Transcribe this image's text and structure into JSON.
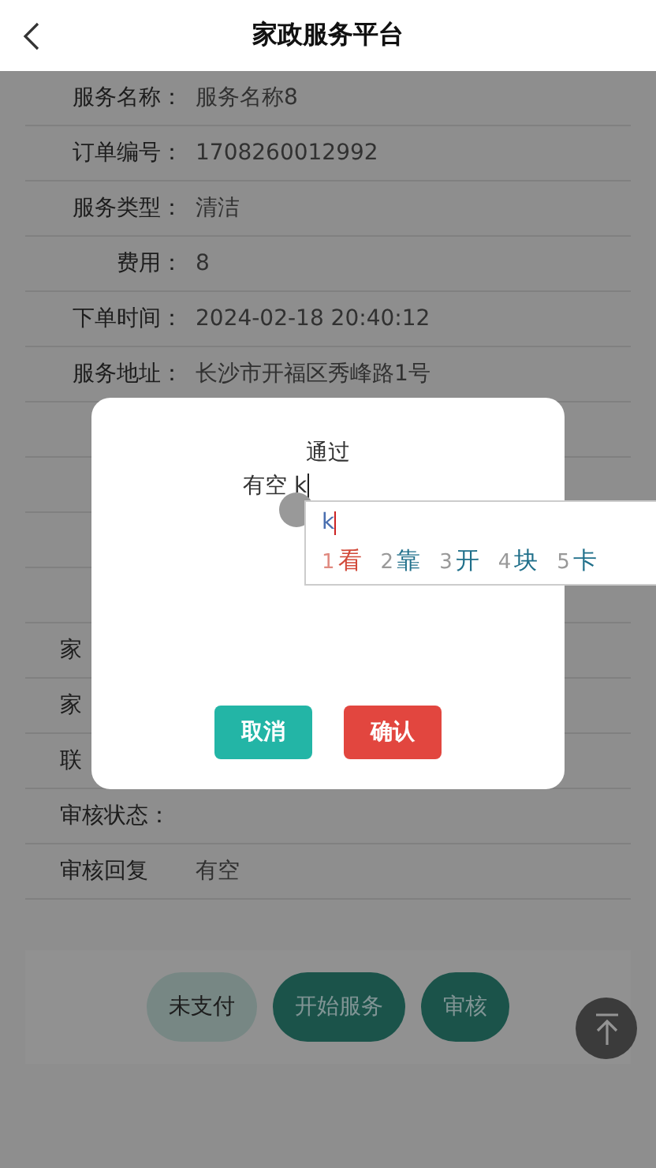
{
  "header": {
    "title": "家政服务平台"
  },
  "details": [
    {
      "label": "服务名称：",
      "value": "服务名称8"
    },
    {
      "label": "订单编号：",
      "value": "1708260012992"
    },
    {
      "label": "服务类型：",
      "value": "清洁"
    },
    {
      "label": "费用：",
      "value": "8"
    },
    {
      "label": "下单时间：",
      "value": "2024-02-18 20:40:12"
    },
    {
      "label": "服务地址：",
      "value": "长沙市开福区秀峰路1号"
    }
  ],
  "details_lower": [
    {
      "label": "家"
    },
    {
      "label": "家"
    },
    {
      "label": "联"
    },
    {
      "label": "审核状态："
    },
    {
      "label": "审核回复",
      "value": "有空"
    }
  ],
  "actions": [
    {
      "label": "未支付",
      "kind": "light"
    },
    {
      "label": "开始服务",
      "kind": "primary"
    },
    {
      "label": "审核",
      "kind": "primary"
    }
  ],
  "dialog": {
    "title": "通过",
    "input": {
      "value": "有空 k"
    },
    "ime": {
      "composition": "k",
      "candidates": [
        {
          "index": "1",
          "text": "看",
          "selected": true
        },
        {
          "index": "2",
          "text": "靠",
          "selected": false
        },
        {
          "index": "3",
          "text": "开",
          "selected": false
        },
        {
          "index": "4",
          "text": "块",
          "selected": false
        },
        {
          "index": "5",
          "text": "卡",
          "selected": false
        }
      ]
    },
    "buttons": [
      {
        "label": "取消",
        "kind": "cancel"
      },
      {
        "label": "确认",
        "kind": "confirm"
      }
    ]
  }
}
